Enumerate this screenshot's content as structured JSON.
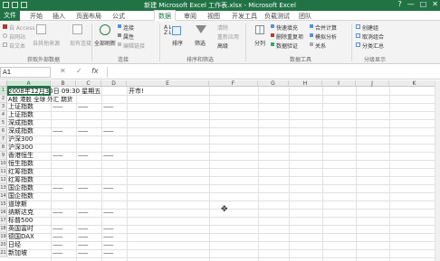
{
  "window": {
    "title": "新建 Microsoft Excel 工作表.xlsx - Microsoft Excel",
    "controls": [
      "?",
      "—",
      "□",
      "✕"
    ]
  },
  "tabs": [
    "文件",
    "开始",
    "插入",
    "页面布局",
    "公式",
    "数据",
    "审阅",
    "视图",
    "开发工具",
    "负载测试",
    "团队"
  ],
  "active_tab": "数据",
  "ribbon": {
    "ext_data": {
      "access": "自 Access",
      "web": "自网站",
      "text": "自文本",
      "other": "自其他来源",
      "existing": "现有连接",
      "group": "获取外部数据"
    },
    "connections": {
      "refresh": "全部刷新",
      "conn": "连接",
      "props": "属性",
      "edit_links": "编辑链接",
      "group": "连接"
    },
    "sort": {
      "sort": "排序",
      "filter": "筛选",
      "clear": "清除",
      "reapply": "重新应用",
      "advanced": "高级",
      "group": "排序和筛选"
    },
    "tools": {
      "split": "分列",
      "flash": "快速填充",
      "dup": "删除重复项",
      "validate": "数据验证",
      "consolidate": "合并计算",
      "whatif": "模拟分析",
      "rel": "关系",
      "group": "数据工具"
    },
    "outline": {
      "grp": "创建组",
      "ungrp": "取消组合",
      "subtotal": "分类汇总",
      "group": "分级显示"
    }
  },
  "formula_bar": {
    "name_box": "A1",
    "cancel": "✕",
    "enter": "✓",
    "fx": "fx",
    "value": ""
  },
  "columns": [
    "A",
    "B",
    "C",
    "D",
    "E",
    "F",
    "G",
    "H",
    "I",
    "J",
    "K"
  ],
  "rows": [
    "1",
    "2",
    "3",
    "4",
    "5",
    "6",
    "7",
    "8",
    "9",
    "10",
    "11",
    "12",
    "13",
    "14",
    "15",
    "16",
    "17",
    "18",
    "19",
    "20",
    "21"
  ],
  "sheet": {
    "a1": "2008年12月30日 09:30 星期五",
    "e1": "开市!",
    "row2": [
      "A股 港股 全球 外汇 期货"
    ],
    "col_a": [
      "上证指数",
      "上证指数",
      "深成指数",
      "深成指数",
      "沪深300",
      "沪深300",
      "香港恒生",
      "恒生指数",
      "红筹指数",
      "红筹指数",
      "国企指数",
      "国企指数",
      "道琼斯",
      "纳斯达克",
      "标普500",
      "英国富时",
      "德国DAX",
      "日经",
      "新加坡"
    ],
    "dash": "——"
  }
}
